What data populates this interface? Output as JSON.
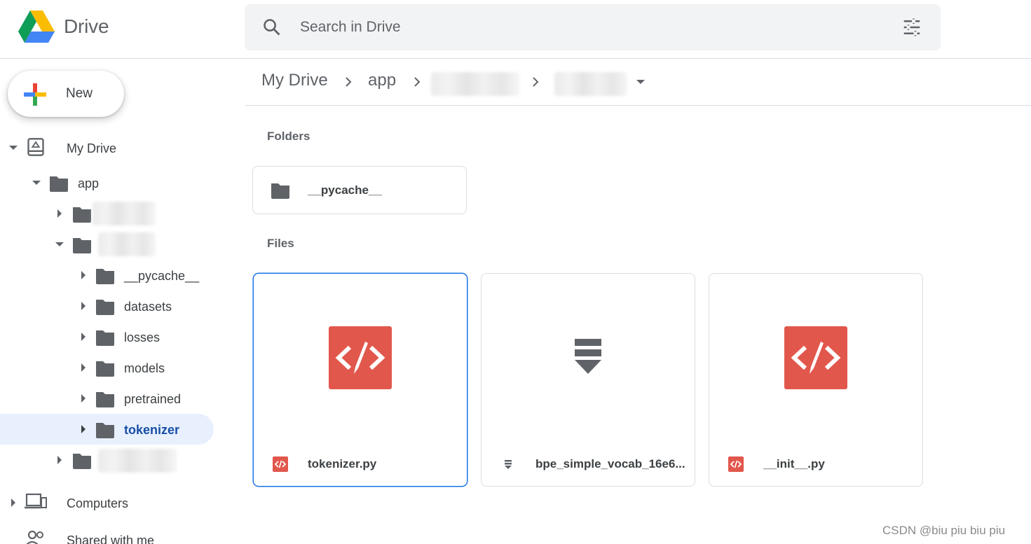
{
  "app": {
    "name": "Drive"
  },
  "search": {
    "placeholder": "Search in Drive"
  },
  "sidebar": {
    "new_label": "New",
    "my_drive_label": "My Drive",
    "tree": [
      {
        "label": "app"
      },
      {
        "label": "__pycache__"
      },
      {
        "label": "datasets"
      },
      {
        "label": "losses"
      },
      {
        "label": "models"
      },
      {
        "label": "pretrained"
      },
      {
        "label": "tokenizer"
      }
    ],
    "computers_label": "Computers",
    "shared_label": "Shared with me"
  },
  "breadcrumb": {
    "items": [
      "My Drive",
      "app"
    ]
  },
  "main": {
    "folders_label": "Folders",
    "files_label": "Files",
    "folders": [
      {
        "name": "__pycache__"
      }
    ],
    "files": [
      {
        "name": "tokenizer.py",
        "type": "code"
      },
      {
        "name": "bpe_simple_vocab_16e6...",
        "type": "archive"
      },
      {
        "name": "__init__.py",
        "type": "code"
      }
    ]
  },
  "watermark": "CSDN @biu piu biu piu",
  "colors": {
    "accent": "#1a73e8",
    "selected_bg": "#e8f0fe",
    "code_icon": "#e2574c",
    "folder": "#5f6368"
  }
}
